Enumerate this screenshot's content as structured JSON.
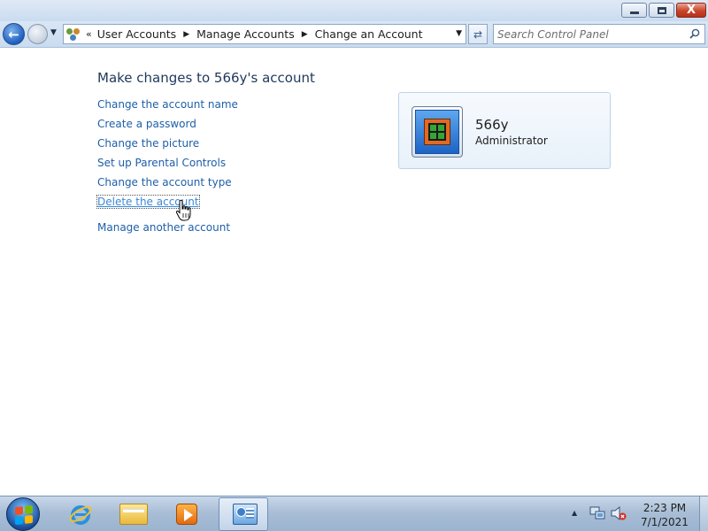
{
  "window": {
    "controls": {
      "minimize": "minimize",
      "maximize": "maximize",
      "close": "X"
    }
  },
  "navigation": {
    "breadcrumb_overflow": "«",
    "breadcrumbs": [
      "User Accounts",
      "Manage Accounts",
      "Change an Account"
    ],
    "search_placeholder": "Search Control Panel"
  },
  "main": {
    "title": "Make changes to 566y's account",
    "tasks": [
      "Change the account name",
      "Create a password",
      "Change the picture",
      "Set up Parental Controls",
      "Change the account type",
      "Delete the account"
    ],
    "other_link": "Manage another account",
    "account": {
      "name": "566y",
      "role": "Administrator"
    }
  },
  "taskbar": {
    "items": [
      "internet-explorer",
      "windows-explorer",
      "windows-media-player",
      "control-panel"
    ],
    "clock_time": "2:23 PM",
    "clock_date": "7/1/2021"
  },
  "colors": {
    "link": "#1e5fa8",
    "link_hover": "#3c88d6",
    "title": "#1e395b"
  }
}
